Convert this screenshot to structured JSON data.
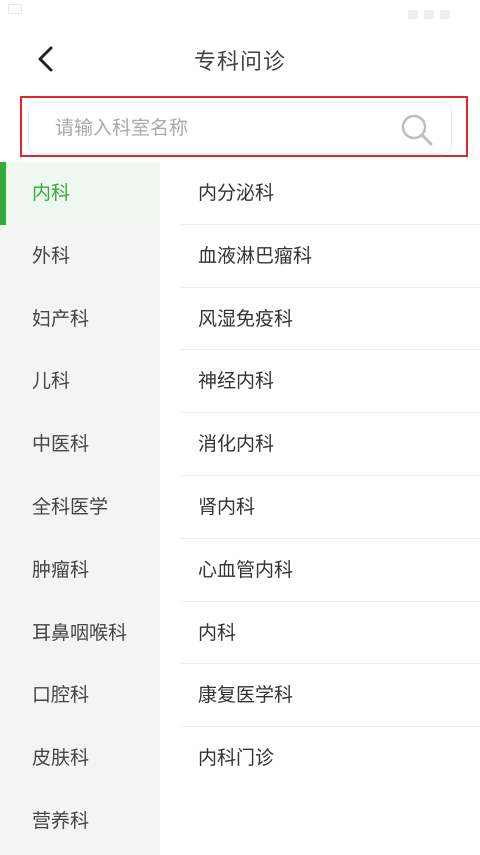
{
  "header": {
    "title": "专科问诊"
  },
  "search": {
    "placeholder": "请输入科室名称"
  },
  "sidebar": {
    "items": [
      {
        "label": "内科",
        "active": true
      },
      {
        "label": "外科"
      },
      {
        "label": "妇产科"
      },
      {
        "label": "儿科"
      },
      {
        "label": "中医科"
      },
      {
        "label": "全科医学"
      },
      {
        "label": "肿瘤科"
      },
      {
        "label": "耳鼻咽喉科"
      },
      {
        "label": "口腔科"
      },
      {
        "label": "皮肤科"
      },
      {
        "label": "营养科"
      }
    ]
  },
  "departments": {
    "items": [
      {
        "label": "内分泌科"
      },
      {
        "label": "血液淋巴瘤科"
      },
      {
        "label": "风湿免疫科"
      },
      {
        "label": "神经内科"
      },
      {
        "label": "消化内科"
      },
      {
        "label": "肾内科"
      },
      {
        "label": "心血管内科"
      },
      {
        "label": "内科"
      },
      {
        "label": "康复医学科"
      },
      {
        "label": "内科门诊"
      }
    ]
  },
  "colors": {
    "accent": "#35a93a",
    "active_bg": "#f0f9ef",
    "sidebar_bg": "#f4f4f4",
    "highlight_outline": "#e0262b"
  },
  "icons": {
    "back": "chevron-left-icon",
    "search": "search-icon"
  }
}
